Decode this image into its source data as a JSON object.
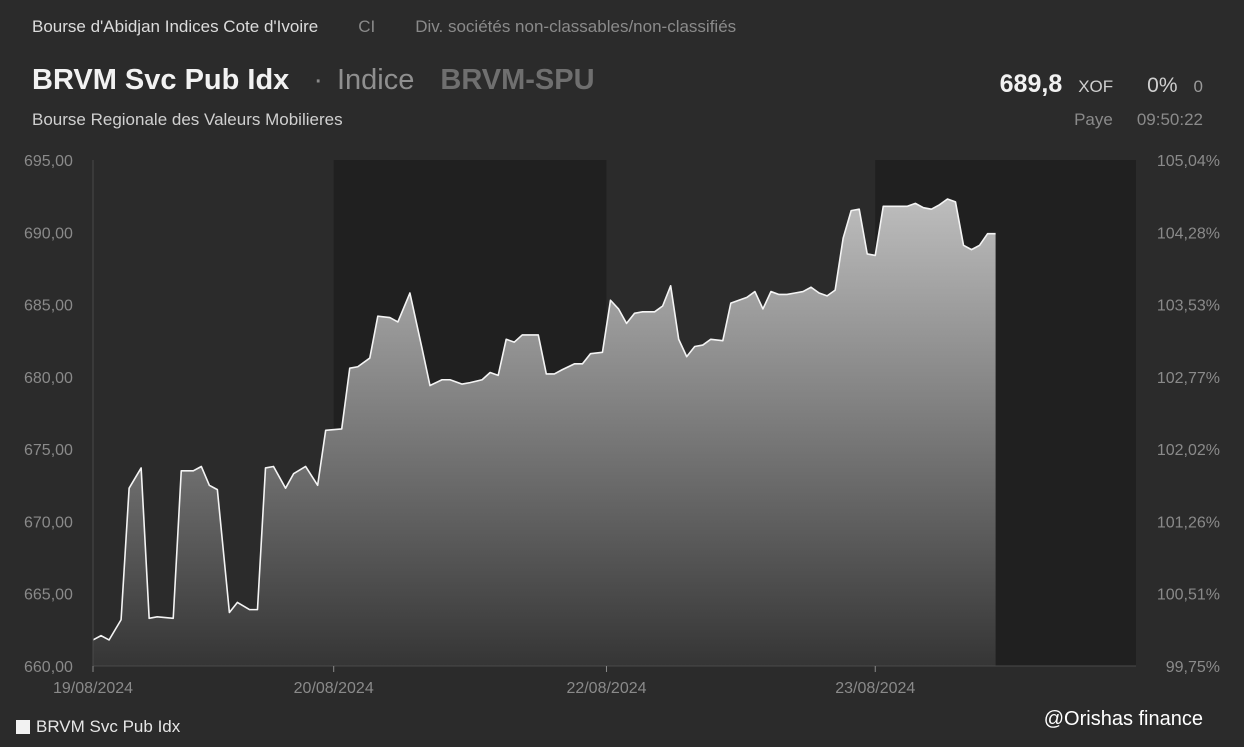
{
  "header": {
    "exchange": "Bourse d'Abidjan Indices Cote d'Ivoire",
    "country": "CI",
    "category": "Div. sociétés non-classables/non-classifiés",
    "name": "BRVM Svc Pub Idx",
    "dot": "·",
    "kind": "Indice",
    "ticker": "BRVM-SPU",
    "market": "Bourse Regionale des Valeurs Mobilieres",
    "price": "689,8",
    "currency": "XOF",
    "change_pct": "0%",
    "change_abs": "0",
    "status_label": "Paye",
    "time": "09:50:22"
  },
  "legend_label": "BRVM Svc Pub Idx",
  "watermark": "@Orishas finance",
  "colors": {
    "background": "#2b2b2b",
    "night_band": "#202020",
    "line": "#f4f4f4",
    "fill_top": "#bdbdbd",
    "fill_bottom": "#353535"
  },
  "chart_data": {
    "type": "area",
    "series": [
      {
        "name": "BRVM Svc Pub Idx",
        "points": [
          [
            0.0,
            661.8
          ],
          [
            1.0,
            662.1
          ],
          [
            2.0,
            661.8
          ],
          [
            3.5,
            663.2
          ],
          [
            4.5,
            672.3
          ],
          [
            6.0,
            673.7
          ],
          [
            7.0,
            663.3
          ],
          [
            8.0,
            663.4
          ],
          [
            10.0,
            663.3
          ],
          [
            11.0,
            673.5
          ],
          [
            12.5,
            673.5
          ],
          [
            13.5,
            673.8
          ],
          [
            14.5,
            672.5
          ],
          [
            15.5,
            672.2
          ],
          [
            17.0,
            663.7
          ],
          [
            18.0,
            664.4
          ],
          [
            19.5,
            663.9
          ],
          [
            20.5,
            663.9
          ],
          [
            21.5,
            673.7
          ],
          [
            22.5,
            673.8
          ],
          [
            24.0,
            672.3
          ],
          [
            25.0,
            673.3
          ],
          [
            26.5,
            673.8
          ],
          [
            28.0,
            672.5
          ],
          [
            29.0,
            676.3
          ],
          [
            31.0,
            676.4
          ],
          [
            32.0,
            680.6
          ],
          [
            33.0,
            680.7
          ],
          [
            34.5,
            681.3
          ],
          [
            35.5,
            684.2
          ],
          [
            37.0,
            684.1
          ],
          [
            38.0,
            683.8
          ],
          [
            39.5,
            685.8
          ],
          [
            41.0,
            682.0
          ],
          [
            42.0,
            679.4
          ],
          [
            43.5,
            679.8
          ],
          [
            44.5,
            679.8
          ],
          [
            46.0,
            679.5
          ],
          [
            47.0,
            679.6
          ],
          [
            48.5,
            679.8
          ],
          [
            49.5,
            680.3
          ],
          [
            50.5,
            680.1
          ],
          [
            51.5,
            682.6
          ],
          [
            52.5,
            682.4
          ],
          [
            53.5,
            682.9
          ],
          [
            55.5,
            682.9
          ],
          [
            56.5,
            680.2
          ],
          [
            57.5,
            680.2
          ],
          [
            58.5,
            680.5
          ],
          [
            60.0,
            680.9
          ],
          [
            61.0,
            680.9
          ],
          [
            62.0,
            681.6
          ],
          [
            63.5,
            681.7
          ],
          [
            64.5,
            685.3
          ],
          [
            65.5,
            684.7
          ],
          [
            66.5,
            683.7
          ],
          [
            67.5,
            684.4
          ],
          [
            68.5,
            684.5
          ],
          [
            70.0,
            684.5
          ],
          [
            71.0,
            684.9
          ],
          [
            72.0,
            686.3
          ],
          [
            73.0,
            682.6
          ],
          [
            74.0,
            681.4
          ],
          [
            75.0,
            682.1
          ],
          [
            76.0,
            682.2
          ],
          [
            77.0,
            682.6
          ],
          [
            78.5,
            682.5
          ],
          [
            79.5,
            685.1
          ],
          [
            80.5,
            685.3
          ],
          [
            81.5,
            685.5
          ],
          [
            82.5,
            685.9
          ],
          [
            83.5,
            684.7
          ],
          [
            84.5,
            685.9
          ],
          [
            85.5,
            685.7
          ],
          [
            86.5,
            685.7
          ],
          [
            87.5,
            685.8
          ],
          [
            88.5,
            685.9
          ],
          [
            89.5,
            686.2
          ],
          [
            90.5,
            685.8
          ],
          [
            91.5,
            685.6
          ],
          [
            92.5,
            686.0
          ],
          [
            93.5,
            689.6
          ],
          [
            94.5,
            691.5
          ],
          [
            95.5,
            691.6
          ],
          [
            96.5,
            688.5
          ],
          [
            97.5,
            688.4
          ],
          [
            98.5,
            691.8
          ],
          [
            100.0,
            691.8
          ],
          [
            101.5,
            691.8
          ],
          [
            102.5,
            692.0
          ],
          [
            103.5,
            691.7
          ],
          [
            104.5,
            691.6
          ],
          [
            105.5,
            691.9
          ],
          [
            106.5,
            692.3
          ],
          [
            107.5,
            692.1
          ],
          [
            108.5,
            689.1
          ],
          [
            109.5,
            688.8
          ],
          [
            110.5,
            689.1
          ],
          [
            111.5,
            689.9
          ],
          [
            112.5,
            689.9
          ]
        ]
      }
    ],
    "x_ticks": [
      {
        "x": 0,
        "label": "19/08/2024"
      },
      {
        "x": 30,
        "label": "20/08/2024"
      },
      {
        "x": 64,
        "label": "22/08/2024"
      },
      {
        "x": 97.5,
        "label": "23/08/2024"
      }
    ],
    "x_range": [
      0,
      130
    ],
    "plot_x_end": 130,
    "data_x_end": 112.5,
    "shaded_bands": [
      [
        30,
        64
      ],
      [
        97.5,
        130
      ]
    ],
    "ylim": [
      660,
      695
    ],
    "y_ticks": [
      "660,00",
      "665,00",
      "670,00",
      "675,00",
      "680,00",
      "685,00",
      "690,00",
      "695,00"
    ],
    "y_tick_values": [
      660,
      665,
      670,
      675,
      680,
      685,
      690,
      695
    ],
    "y2_ticks": [
      "99,75%",
      "100,51%",
      "101,26%",
      "102,02%",
      "102,77%",
      "103,53%",
      "104,28%",
      "105,04%"
    ],
    "grid": false,
    "legend": "bottom-left"
  }
}
